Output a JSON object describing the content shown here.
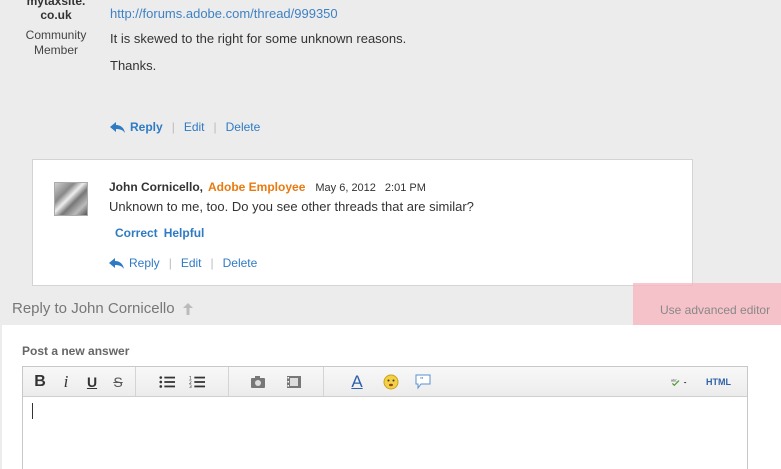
{
  "user": {
    "name_line1": "mytaxsite.",
    "name_line2": "co.uk",
    "role_line1": "Community",
    "role_line2": "Member"
  },
  "post": {
    "link": "http://forums.adobe.com/thread/999350",
    "line1": "It is skewed to the right for some unknown reasons.",
    "line2": "Thanks.",
    "actions": {
      "reply": "Reply",
      "edit": "Edit",
      "delete": "Delete"
    }
  },
  "reply": {
    "author": "John Cornicello,",
    "badge": "Adobe Employee",
    "date": "May 6, 2012",
    "time": "2:01 PM",
    "text": "Unknown to me, too. Do you see other threads that are similar?",
    "tags": [
      "Correct",
      "Helpful"
    ],
    "actions": {
      "reply": "Reply",
      "edit": "Edit",
      "delete": "Delete"
    }
  },
  "reply_to": "Reply to John Cornicello",
  "advanced_editor": "Use advanced editor",
  "editor": {
    "heading": "Post a new answer",
    "toolbar": {
      "bold": "B",
      "italic": "i",
      "underline": "U",
      "strike": "S",
      "font": "A",
      "html": "HTML",
      "spell": "abc"
    }
  },
  "colors": {
    "link": "#2e7bc4",
    "employee": "#e87a10",
    "background": "#ececec"
  }
}
